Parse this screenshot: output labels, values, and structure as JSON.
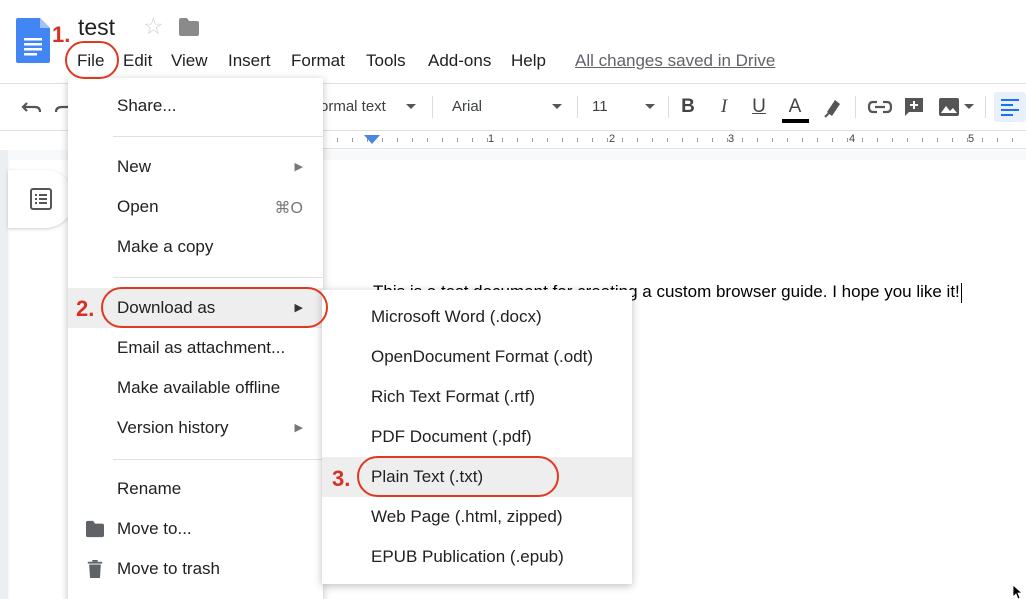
{
  "header": {
    "title": "test",
    "save_status": "All changes saved in Drive",
    "menus": [
      "File",
      "Edit",
      "View",
      "Insert",
      "Format",
      "Tools",
      "Add-ons",
      "Help"
    ]
  },
  "toolbar": {
    "style_value": "ormal text",
    "font_value": "Arial",
    "size_value": "11",
    "bold_label": "B",
    "italic_label": "I",
    "underline_label": "U",
    "text_color_label": "A",
    "text_color": "#000000",
    "icons": [
      "undo-icon",
      "redo-icon",
      "bold-icon",
      "italic-icon",
      "underline-icon",
      "text-color-icon",
      "highlight-icon",
      "link-icon",
      "comment-icon",
      "image-icon",
      "align-left-icon"
    ]
  },
  "ruler": {
    "numbers": [
      "1",
      "2",
      "3",
      "4",
      "5"
    ]
  },
  "document": {
    "body_text": "This is a test document for creating a custom browser guide. I hope you like it!"
  },
  "file_menu": {
    "share": "Share...",
    "new": "New",
    "open": "Open",
    "open_shortcut": "⌘O",
    "make_copy": "Make a copy",
    "download_as": "Download as",
    "email_attachment": "Email as attachment...",
    "offline": "Make available offline",
    "version_history": "Version history",
    "rename": "Rename",
    "move_to": "Move to...",
    "move_to_trash": "Move to trash"
  },
  "download_menu": {
    "items": [
      "Microsoft Word (.docx)",
      "OpenDocument Format (.odt)",
      "Rich Text Format (.rtf)",
      "PDF Document (.pdf)",
      "Plain Text (.txt)",
      "Web Page (.html, zipped)",
      "EPUB Publication (.epub)"
    ]
  },
  "annotations": {
    "step1": "1.",
    "step2": "2.",
    "step3": "3."
  },
  "colors": {
    "annotation_red": "#d93025",
    "docs_blue": "#4285f4",
    "ruler_marker": "#4a86e8",
    "menu_highlight": "#eeeeee"
  }
}
